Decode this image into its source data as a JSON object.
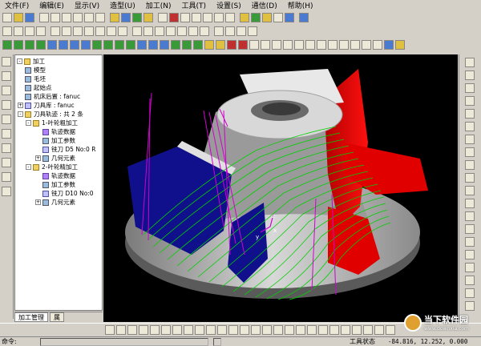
{
  "menu": [
    "文件(F)",
    "编辑(E)",
    "显示(V)",
    "造型(U)",
    "加工(N)",
    "工具(T)",
    "设置(S)",
    "通信(D)",
    "帮助(H)"
  ],
  "tree": {
    "root": "加工",
    "model": "模型",
    "blank": "毛坯",
    "start_point": "起始点",
    "post_processor": "机床后置 : fanuc",
    "tool_library": "刀具库 : fanuc",
    "toolpaths": "刀具轨迹 : 共 2 条",
    "op1": "1-叶轮粗加工",
    "op1_path": "轨迹数据",
    "op1_params": "加工参数",
    "op1_tool": "铣刀 D5 No:0 R",
    "op1_geom": "几何元素",
    "op2": "2-叶轮精加工",
    "op2_path": "轨迹数据",
    "op2_params": "加工参数",
    "op2_tool": "铣刀 D10 No:0",
    "op2_geom": "几何元素"
  },
  "tabs": [
    "加工管理",
    "属"
  ],
  "axes": {
    "z": "z",
    "y": "y",
    "x": "x"
  },
  "status": {
    "command_label": "命令:",
    "tool_state_label": "工具状态",
    "coordinates": "-84.816, 12.252, 0.000"
  },
  "watermark": {
    "title": "当下软件园",
    "subtitle": "www.downxia.com"
  },
  "colors": {
    "viewport_bg": "#000000",
    "hub": "#c8c8c8",
    "blade_red": "#e00000",
    "blade_blue": "#10108c",
    "toolpath": "#00d000",
    "tool_lines": "#d000d0"
  }
}
